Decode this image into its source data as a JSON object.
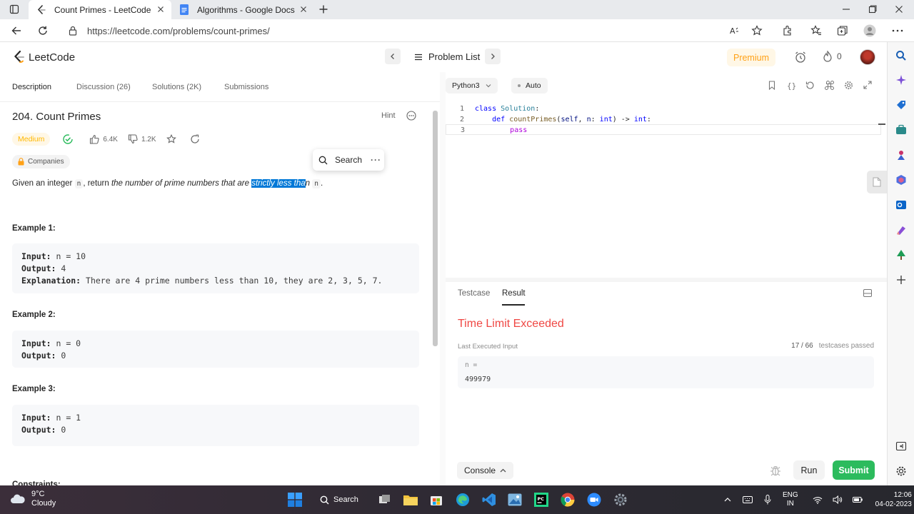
{
  "browser": {
    "tabs": [
      {
        "title": "Count Primes - LeetCode",
        "active": true
      },
      {
        "title": "Algorithms - Google Docs",
        "active": false
      }
    ],
    "url": "https://leetcode.com/problems/count-primes/"
  },
  "header": {
    "logo_text": "LeetCode",
    "problem_list": "Problem List",
    "premium": "Premium",
    "streak_count": "0"
  },
  "problem": {
    "tabs": [
      "Description",
      "Discussion (26)",
      "Solutions (2K)",
      "Submissions"
    ],
    "title": "204. Count Primes",
    "hint": "Hint",
    "difficulty": "Medium",
    "likes": "6.4K",
    "dislikes": "1.2K",
    "companies": "Companies",
    "description": {
      "pre": "Given an integer ",
      "var1": "n",
      "mid": ", return ",
      "em": "the number of prime numbers that are ",
      "highlight": "strictly less tha",
      "after_hl": "n",
      "var2": "n",
      "end": "."
    },
    "examples": [
      {
        "title": "Example 1:",
        "lines": [
          {
            "k": "Input:",
            "v": " n = 10"
          },
          {
            "k": "Output:",
            "v": " 4"
          },
          {
            "k": "Explanation:",
            "v": " There are 4 prime numbers less than 10, they are 2, 3, 5, 7."
          }
        ]
      },
      {
        "title": "Example 2:",
        "lines": [
          {
            "k": "Input:",
            "v": " n = 0"
          },
          {
            "k": "Output:",
            "v": " 0"
          }
        ]
      },
      {
        "title": "Example 3:",
        "lines": [
          {
            "k": "Input:",
            "v": " n = 1"
          },
          {
            "k": "Output:",
            "v": " 0"
          }
        ]
      }
    ],
    "constraints_title": "Constraints:"
  },
  "search_popup": {
    "label": "Search",
    "more": "···"
  },
  "editor": {
    "language": "Python3",
    "mode": "Auto",
    "line_numbers": [
      "1",
      "2",
      "3"
    ],
    "code": {
      "l1_kw": "class",
      "l1_cls": "Solution",
      "l1_end": ":",
      "l2_kw": "def",
      "l2_fn": "countPrimes",
      "l2_open": "(",
      "l2_self": "self",
      "l2_comma": ", ",
      "l2_n": "n",
      "l2_colon": ": ",
      "l2_type": "int",
      "l2_close": ") -> ",
      "l2_ret": "int",
      "l2_end": ":",
      "l3_kw": "pass"
    }
  },
  "result": {
    "tabs": [
      "Testcase",
      "Result"
    ],
    "status": "Time Limit Exceeded",
    "last_input_label": "Last Executed Input",
    "passed_count": "17 / 66",
    "passed_label": "testcases passed",
    "input_name": "n =",
    "input_value": "499979",
    "console": "Console",
    "run": "Run",
    "submit": "Submit"
  },
  "taskbar": {
    "temperature": "9°C",
    "weather": "Cloudy",
    "search": "Search",
    "lang_top": "ENG",
    "lang_bottom": "IN",
    "time": "12:06",
    "date": "04-02-2023"
  },
  "colors": {
    "accent_orange": "#ffa116",
    "medium_yellow": "#ffb800",
    "error_red": "#ef4743",
    "submit_green": "#2cbb5d",
    "selection_blue": "#0078d7"
  }
}
